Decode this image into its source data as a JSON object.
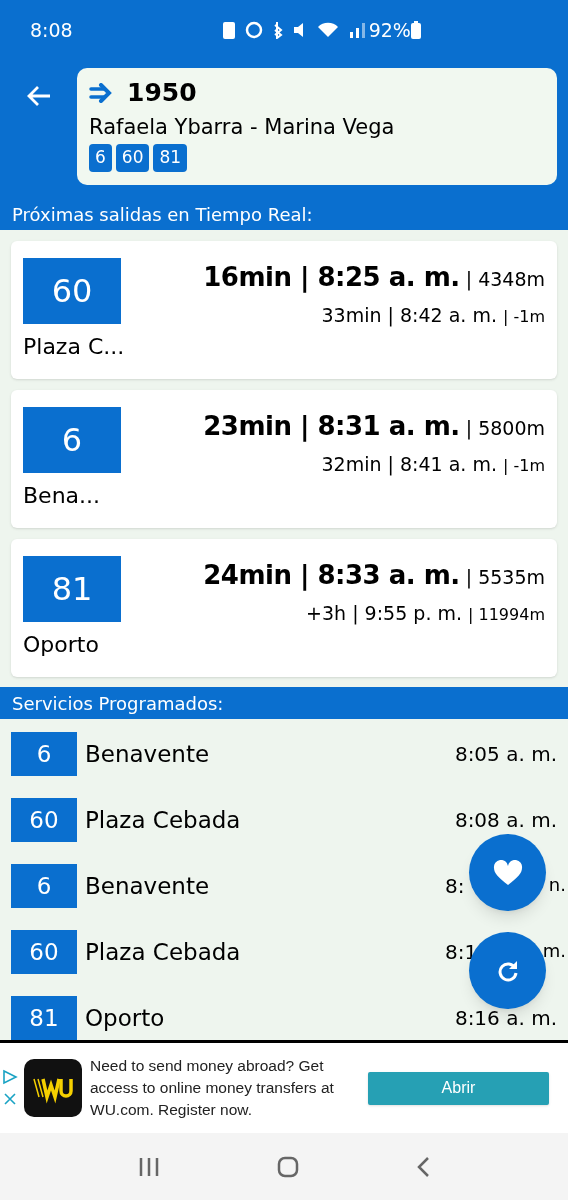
{
  "status_bar": {
    "time": "8:08",
    "battery": "92%"
  },
  "header": {
    "stop_number": "1950",
    "stop_name": "Rafaela Ybarra - Marina Vega",
    "lines": [
      "6",
      "60",
      "81"
    ]
  },
  "realtime": {
    "title": "Próximas salidas en Tiempo Real:",
    "arrivals": [
      {
        "line": "60",
        "destination": "Plaza C...",
        "first": {
          "time": "16min | 8:25 a. m.",
          "distance": "| 4348m"
        },
        "second": {
          "time": "33min | 8:42 a. m.",
          "distance": "| -1m"
        }
      },
      {
        "line": "6",
        "destination": "Bena...",
        "first": {
          "time": "23min | 8:31 a. m.",
          "distance": "| 5800m"
        },
        "second": {
          "time": "32min | 8:41 a. m.",
          "distance": "| -1m"
        }
      },
      {
        "line": "81",
        "destination": "Oporto",
        "first": {
          "time": "24min | 8:33 a. m.",
          "distance": "| 5535m"
        },
        "second": {
          "time": "+3h | 9:55 p. m.",
          "distance": "| 11994m"
        }
      }
    ]
  },
  "scheduled": {
    "title": "Servicios Programados:",
    "services": [
      {
        "line": "6",
        "destination": "Benavente",
        "time": "8:05 a. m."
      },
      {
        "line": "60",
        "destination": "Plaza Cebada",
        "time": "8:08 a. m."
      },
      {
        "line": "6",
        "destination": "Benavente",
        "time_start": "8:",
        "time_end": "n."
      },
      {
        "line": "60",
        "destination": "Plaza Cebada",
        "time_start": "8:1",
        "time_end": "m."
      },
      {
        "line": "81",
        "destination": "Oporto",
        "time": "8:16 a. m."
      }
    ]
  },
  "ad": {
    "text": "Need to send money abroad? Get access to online money transfers at WU.com. Register now.",
    "button": "Abrir"
  }
}
